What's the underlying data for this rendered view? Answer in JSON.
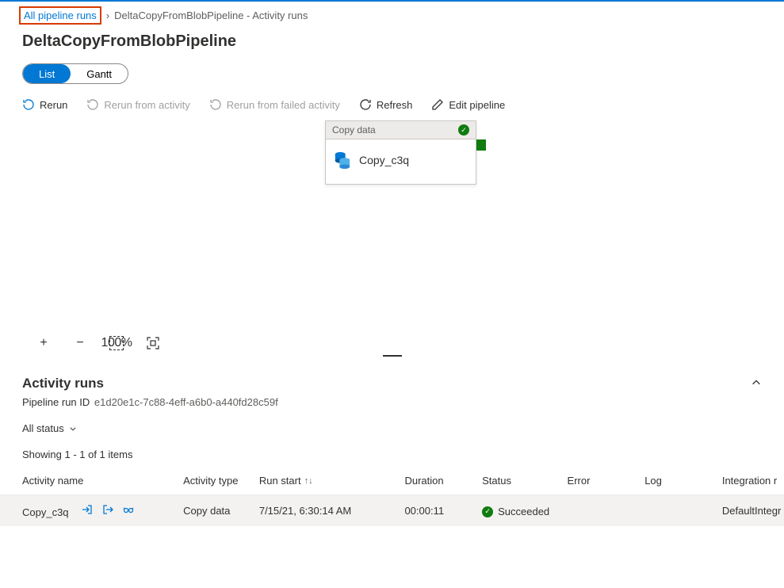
{
  "breadcrumb": {
    "link": "All pipeline runs",
    "current": "DeltaCopyFromBlobPipeline - Activity runs"
  },
  "page_title": "DeltaCopyFromBlobPipeline",
  "view_toggle": {
    "list": "List",
    "gantt": "Gantt"
  },
  "toolbar": {
    "rerun": "Rerun",
    "rerun_from_activity": "Rerun from activity",
    "rerun_from_failed": "Rerun from failed activity",
    "refresh": "Refresh",
    "edit_pipeline": "Edit pipeline"
  },
  "activity_card": {
    "header": "Copy data",
    "name": "Copy_c3q"
  },
  "zoom": {
    "hundred": "100%"
  },
  "section": {
    "title": "Activity runs",
    "run_id_label": "Pipeline run ID",
    "run_id_value": "e1d20e1c-7c88-4eff-a6b0-a440fd28c59f",
    "filter_label": "All status",
    "showing": "Showing 1 - 1 of 1 items"
  },
  "columns": {
    "name": "Activity name",
    "type": "Activity type",
    "start": "Run start",
    "duration": "Duration",
    "status": "Status",
    "error": "Error",
    "log": "Log",
    "integration": "Integration r"
  },
  "rows": [
    {
      "name": "Copy_c3q",
      "type": "Copy data",
      "start": "7/15/21, 6:30:14 AM",
      "duration": "00:00:11",
      "status": "Succeeded",
      "error": "",
      "log": "",
      "integration": "DefaultIntegr"
    }
  ]
}
